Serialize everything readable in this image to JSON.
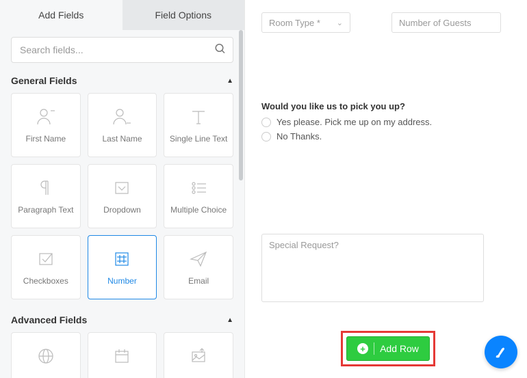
{
  "tabs": {
    "add": "Add Fields",
    "options": "Field Options"
  },
  "search": {
    "placeholder": "Search fields..."
  },
  "sections": {
    "general": {
      "title": "General Fields"
    },
    "advanced": {
      "title": "Advanced Fields"
    }
  },
  "fields": {
    "first_name": "First Name",
    "last_name": "Last Name",
    "single_line": "Single Line Text",
    "paragraph": "Paragraph Text",
    "dropdown": "Dropdown",
    "multiple_choice": "Multiple Choice",
    "checkboxes": "Checkboxes",
    "number": "Number",
    "email": "Email"
  },
  "form": {
    "room_type": "Room Type *",
    "guests": "Number of Guests",
    "pickup_q": "Would you like us to pick you up?",
    "pickup_yes": "Yes please. Pick me up on my address.",
    "pickup_no": "No Thanks.",
    "special_request": "Special Request?"
  },
  "buttons": {
    "add_row": "Add Row"
  },
  "colors": {
    "accent": "#1e88e5",
    "success": "#2ecc40",
    "highlight": "#e53935",
    "fab": "#0a84ff"
  }
}
